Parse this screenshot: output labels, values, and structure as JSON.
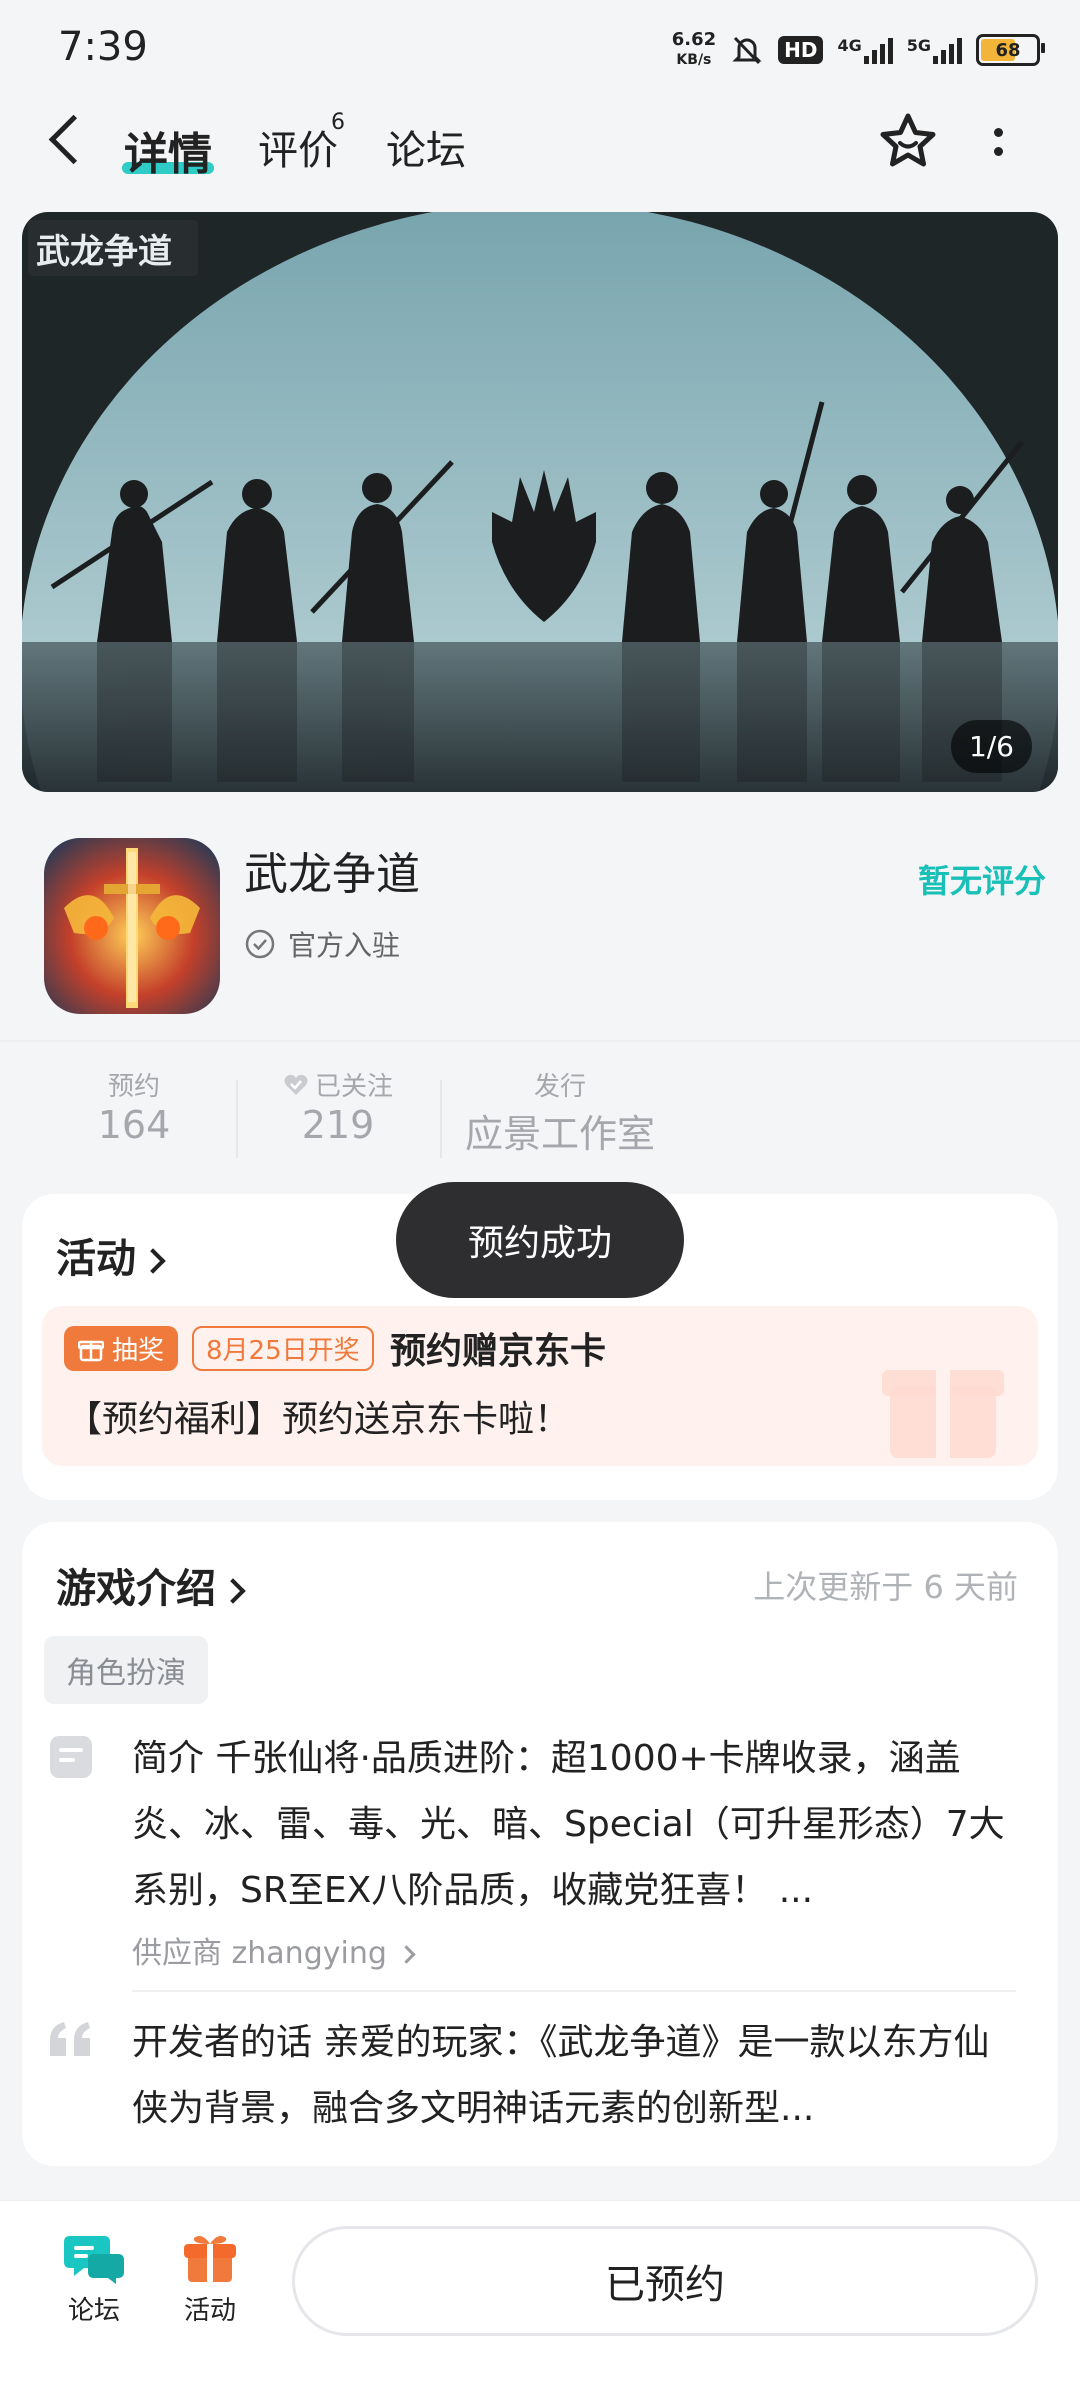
{
  "status_bar": {
    "time": "7:39",
    "net_speed_value": "6.62",
    "net_speed_unit": "KB/s",
    "hd": "HD",
    "sig1": "4G",
    "sig2": "5G",
    "battery": "68"
  },
  "header": {
    "tabs": [
      {
        "label": "详情"
      },
      {
        "label": "评价"
      },
      {
        "label": "论坛"
      }
    ],
    "review_count": "6"
  },
  "banner": {
    "game_logo_text": "武龙争道",
    "counter": "1/6"
  },
  "app": {
    "name": "武龙争道",
    "official_label": "官方入驻",
    "rating": "暂无评分"
  },
  "stats": [
    {
      "label": "预约",
      "value": "164"
    },
    {
      "label": "已关注",
      "value": "219"
    },
    {
      "label": "发行",
      "value": "应景工作室"
    }
  ],
  "activity": {
    "title": "活动",
    "lottery_label": "抽奖",
    "date_label": "8月25日开奖",
    "event_title": "预约赠京东卡",
    "event_desc": "【预约福利】预约送京东卡啦！"
  },
  "toast": "预约成功",
  "intro": {
    "title": "游戏介绍",
    "updated": "上次更新于 6 天前",
    "tag": "角色扮演",
    "summary": "简介 千张仙将·品质进阶：超1000+卡牌收录，涵盖炎、冰、雷、毒、光、暗、Special（可升星形态）7大系别，SR至EX八阶品质，收藏党狂喜！ ...",
    "supplier": "供应商 zhangying",
    "dev_words": "开发者的话 亲爱的玩家：《武龙争道》是一款以东方仙侠为背景，融合多文明神话元素的创新型..."
  },
  "bottom_nav": {
    "forum": "论坛",
    "activity": "活动",
    "reserve_button": "已预约"
  },
  "colors": {
    "accent": "#19c6c1",
    "orange": "#f07a3c",
    "toast_bg": "#2e2e30"
  }
}
